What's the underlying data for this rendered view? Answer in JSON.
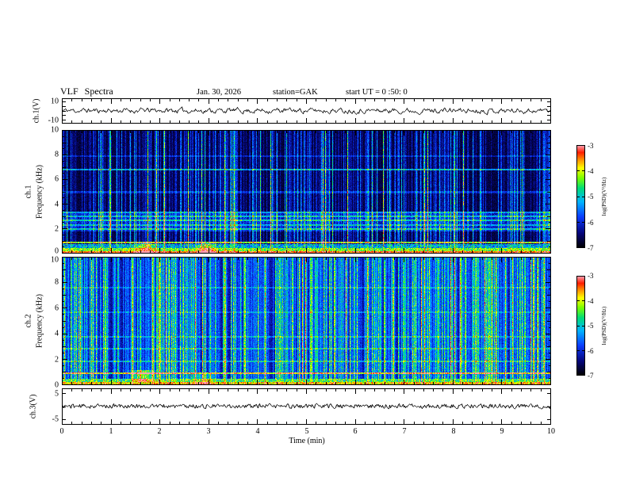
{
  "header": {
    "title": "VLF  Spectra",
    "date": "Jan. 30, 2026",
    "station": "station=GAK",
    "start_ut": "start UT =  0 :50: 0"
  },
  "labels": {
    "ch1_wave": "ch.1(V)",
    "ch1": "ch.1",
    "ch2": "ch.2",
    "freq": "Frequency (kHz)",
    "ch3_wave": "ch.3(V)",
    "time_axis": "Time (min)"
  },
  "axes": {
    "x_ticks": [
      "0",
      "1",
      "2",
      "3",
      "4",
      "5",
      "6",
      "7",
      "8",
      "9",
      "10"
    ],
    "freq_ticks": [
      "10",
      "8",
      "6",
      "4",
      "2",
      "0"
    ],
    "ch1_wave_ticks": [
      "10",
      "-10"
    ],
    "ch3_wave_ticks": [
      "5",
      "-5"
    ]
  },
  "colorbar": {
    "label": "log(PSD)(V²/Hz)",
    "ticks": [
      "-3",
      "-4",
      "-5",
      "-6",
      "-7"
    ]
  },
  "chart_data": [
    {
      "id": "ch1_waveform",
      "type": "line",
      "ylabel": "ch.1(V)",
      "xlabel": "Time (min)",
      "xlim": [
        0,
        10
      ],
      "ylim": [
        -13,
        13
      ],
      "yticks": [
        10,
        -10
      ],
      "description": "Noisy broadband voltage trace fluctuating about 0 V with roughly ±3 V excursions for the full 10 minutes",
      "noise": {
        "seed": 11,
        "amplitude": 2.1,
        "smoothing": 0.62
      }
    },
    {
      "id": "ch1_spectrogram",
      "type": "heatmap",
      "ylabel": "Frequency (kHz)",
      "xlabel": "Time (min)",
      "zlabel": "log(PSD)(V²/Hz)",
      "xlim": [
        0,
        10
      ],
      "ylim": [
        0,
        10
      ],
      "zlim": [
        -7,
        -3
      ],
      "yticks": [
        10,
        8,
        6,
        4,
        2,
        0
      ],
      "description": "Mostly dark (-7) background with dense vertical sferic streaks (blue/green), raised dark-blue band 2-3.4 kHz, narrow horizontal hum lines, bright red/orange band below ~0.5 kHz with red blobs near t=1.7 and t=3.0 min",
      "seed": 21,
      "floor": -6.9,
      "floor_noise": 0.32,
      "streaks": {
        "p_strong": 0.05,
        "p_med": 0.15,
        "p_weak": 0.3,
        "strong": 2.6,
        "med": 1.6,
        "weak": 0.8,
        "carry": 0.25,
        "hf_rolloff": 0.3
      },
      "lines": [
        {
          "f": 0.95,
          "amp": 2.4
        },
        {
          "f": 2.0,
          "amp": 1.0
        },
        {
          "f": 2.35,
          "amp": 0.8
        },
        {
          "f": 2.7,
          "amp": 1.1
        },
        {
          "f": 3.05,
          "amp": 0.9
        },
        {
          "f": 3.35,
          "amp": 0.7
        },
        {
          "f": 5.0,
          "amp": 0.6
        },
        {
          "f": 6.85,
          "amp": 1.3
        },
        {
          "f": 7.9,
          "amp": 0.5
        }
      ],
      "band": {
        "f0": 1.8,
        "f1": 3.4,
        "amp": 0.7
      },
      "bottom": [
        {
          "f0": 0.0,
          "f1": 0.22,
          "level": -3.5,
          "jitter": 0.4
        },
        {
          "f0": 0.22,
          "f1": 0.45,
          "level": -4.4,
          "jitter": 0.6
        },
        {
          "f0": 0.45,
          "f1": 0.8,
          "level": -5.3,
          "jitter": 0.8
        }
      ],
      "blobs": [
        {
          "t": 1.7,
          "sigma": 0.12,
          "f0": 0.1,
          "f1": 0.95,
          "amp": 1.3
        },
        {
          "t": 2.95,
          "sigma": 0.1,
          "f0": 0.1,
          "f1": 0.85,
          "amp": 1.5
        }
      ]
    },
    {
      "id": "ch2_spectrogram",
      "type": "heatmap",
      "ylabel": "Frequency (kHz)",
      "xlabel": "Time (min)",
      "zlabel": "log(PSD)(V²/Hz)",
      "xlim": [
        0,
        10
      ],
      "ylim": [
        0,
        10
      ],
      "zlim": [
        -7,
        -3
      ],
      "yticks": [
        10,
        8,
        6,
        4,
        2,
        0
      ],
      "description": "Brighter channel: dense green/cyan vertical streaks over blue background at all frequencies, horizontal hum lines, bright band below ~0.5 kHz, green blob near t=1.65 min",
      "seed": 33,
      "floor": -6.55,
      "floor_noise": 0.4,
      "streaks": {
        "p_strong": 0.1,
        "p_med": 0.25,
        "p_weak": 0.3,
        "strong": 2.5,
        "med": 1.8,
        "weak": 0.9,
        "carry": 0.5,
        "hf_rolloff": 0.1
      },
      "lines": [
        {
          "f": 0.95,
          "amp": 2.0
        },
        {
          "f": 1.9,
          "amp": 0.8
        },
        {
          "f": 2.85,
          "amp": 0.7
        },
        {
          "f": 3.8,
          "amp": 0.6
        },
        {
          "f": 5.7,
          "amp": 0.5
        },
        {
          "f": 7.6,
          "amp": 0.5
        }
      ],
      "bottom": [
        {
          "f0": 0.0,
          "f1": 0.25,
          "level": -4.0,
          "jitter": 0.6
        },
        {
          "f0": 0.25,
          "f1": 0.55,
          "level": -4.8,
          "jitter": 0.7
        }
      ],
      "blobs": [
        {
          "t": 1.65,
          "sigma": 0.15,
          "f0": 0.25,
          "f1": 1.2,
          "amp": 1.6
        },
        {
          "t": 2.9,
          "sigma": 0.12,
          "f0": 0.1,
          "f1": 0.9,
          "amp": 1.0
        }
      ]
    },
    {
      "id": "ch3_waveform",
      "type": "line",
      "ylabel": "ch.3(V)",
      "xlabel": "Time (min)",
      "xlim": [
        0,
        10
      ],
      "ylim": [
        -7,
        7
      ],
      "yticks": [
        5,
        -5
      ],
      "description": "Essentially flat trace at 0 V for the full 10 minutes",
      "noise": {
        "seed": 44,
        "amplitude": 0.8,
        "smoothing": 0.3
      }
    }
  ]
}
